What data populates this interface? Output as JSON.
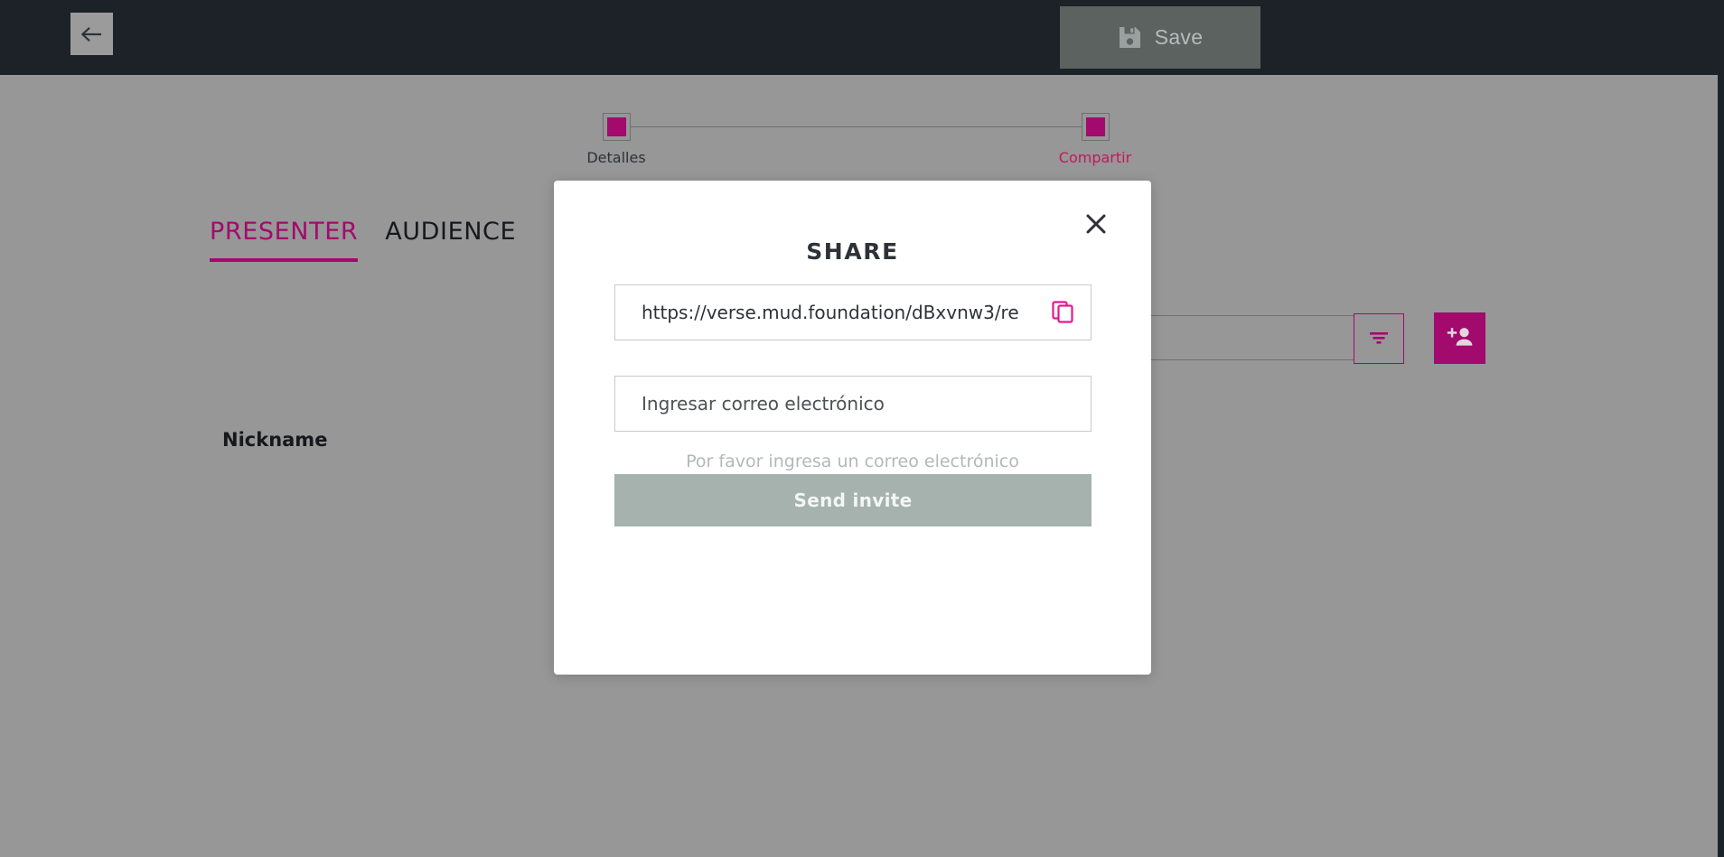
{
  "topbar": {
    "back_icon": "arrow-left-icon",
    "save_label": "Save",
    "save_icon": "floppy-disk-icon"
  },
  "stepper": {
    "steps": [
      {
        "label": "Detalles",
        "active": false
      },
      {
        "label": "Compartir",
        "active": true
      }
    ]
  },
  "tabs": [
    {
      "label": "PRESENTER",
      "active": true
    },
    {
      "label": "AUDIENCE",
      "active": false
    }
  ],
  "toolbar": {
    "search_placeholder": "",
    "search_value": "",
    "filter_icon": "filter-icon",
    "add_user_icon": "add-person-icon"
  },
  "table": {
    "columns": [
      "Nickname"
    ]
  },
  "modal": {
    "title": "SHARE",
    "close_icon": "close-icon",
    "share_link": "https://verse.mud.foundation/dBxvnw3/re",
    "copy_icon": "copy-icon",
    "email_placeholder": "Ingresar correo electrónico",
    "email_value": "",
    "email_hint": "Por favor ingresa un correo electrónico",
    "send_invite_label": "Send invite"
  },
  "colors": {
    "accent": "#a30a6d",
    "accent_text": "#c2185b",
    "topbar_bg": "#1d2228",
    "page_bg": "#979797",
    "modal_bg": "#ffffff",
    "disabled_button": "#a5b2ad",
    "save_button": "#5b6260"
  }
}
